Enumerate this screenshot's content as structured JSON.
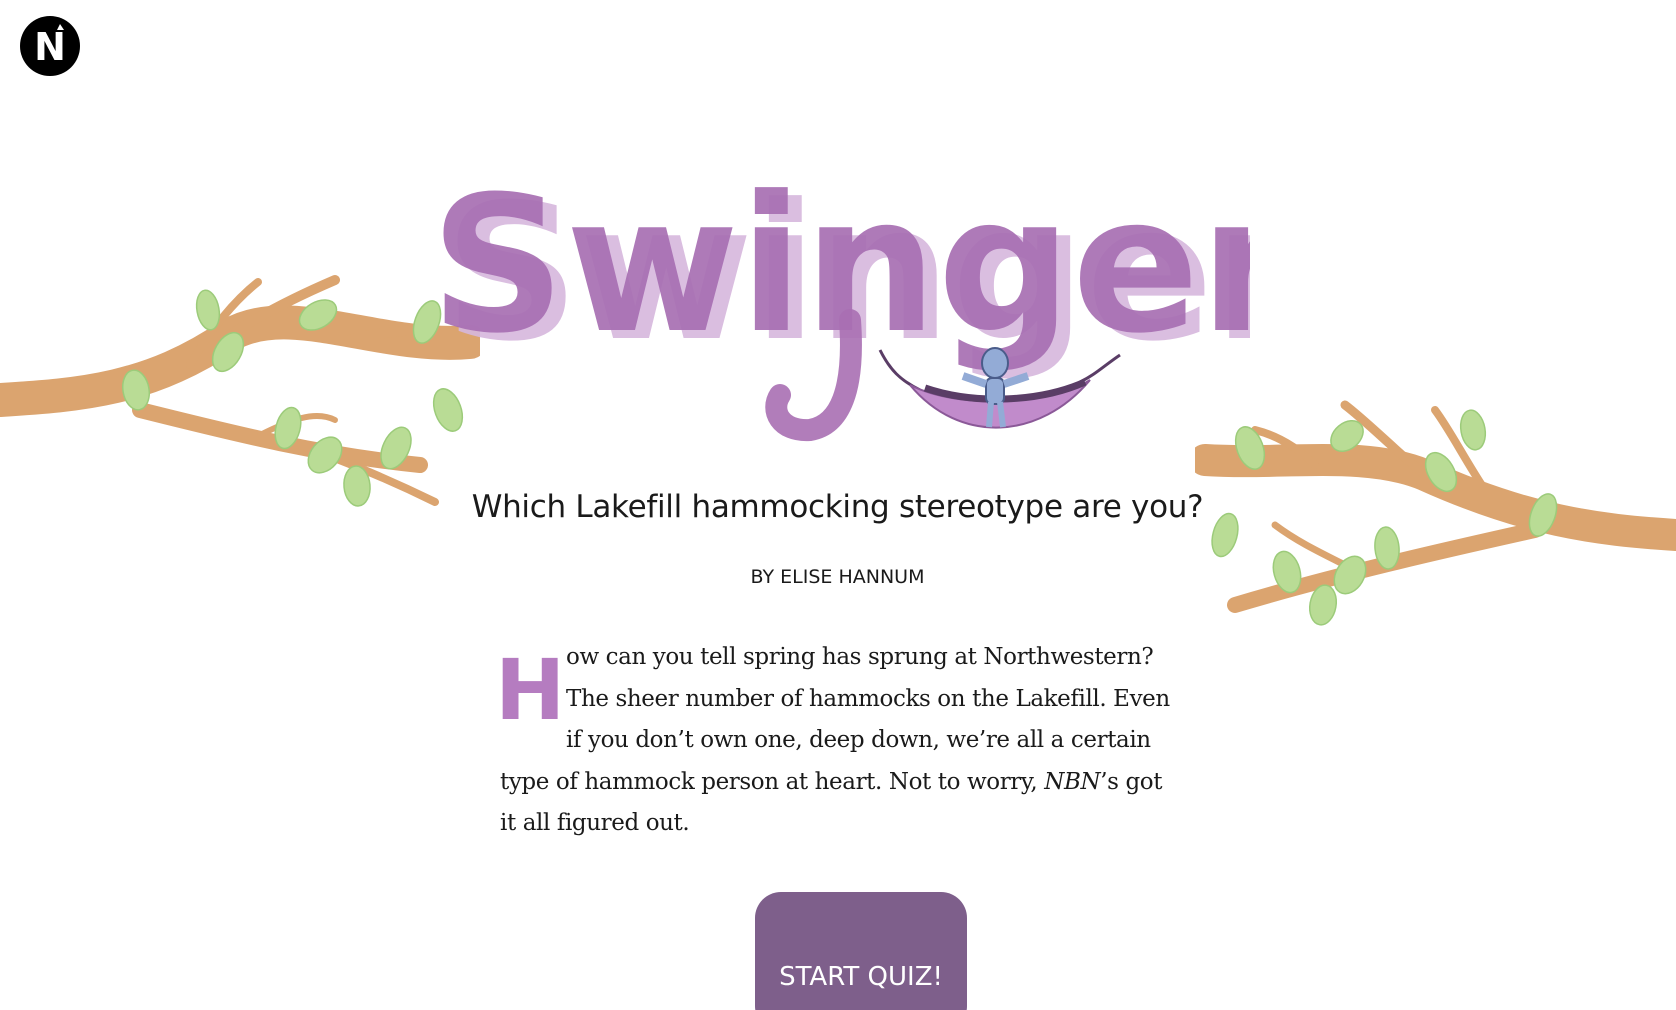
{
  "brand": {
    "logo_letter": "N",
    "logo_icon": "north-by-northwestern-logo-icon"
  },
  "hero": {
    "title": "Swingers!",
    "subtitle": "Which Lakefill hammocking stereotype are you?",
    "byline": "BY ELISE HANNUM"
  },
  "intro": {
    "drop_cap": "H",
    "text_before_italic": "ow can you tell spring has sprung at Northwestern? The sheer number of hammocks on the Lakefill. Even if you don’t own one, deep down, we’re all a certain type of hammock person at heart. Not to worry, ",
    "italic_text": "NBN",
    "text_after_italic": "’s got it all figured out."
  },
  "cta": {
    "start_label": "START QUIZ!"
  },
  "colors": {
    "accent_purple": "#a86fb3",
    "button_purple": "#7e5f8b",
    "branch": "#dba46f",
    "leaf": "#b9dc95",
    "text": "#1a1a1a"
  }
}
